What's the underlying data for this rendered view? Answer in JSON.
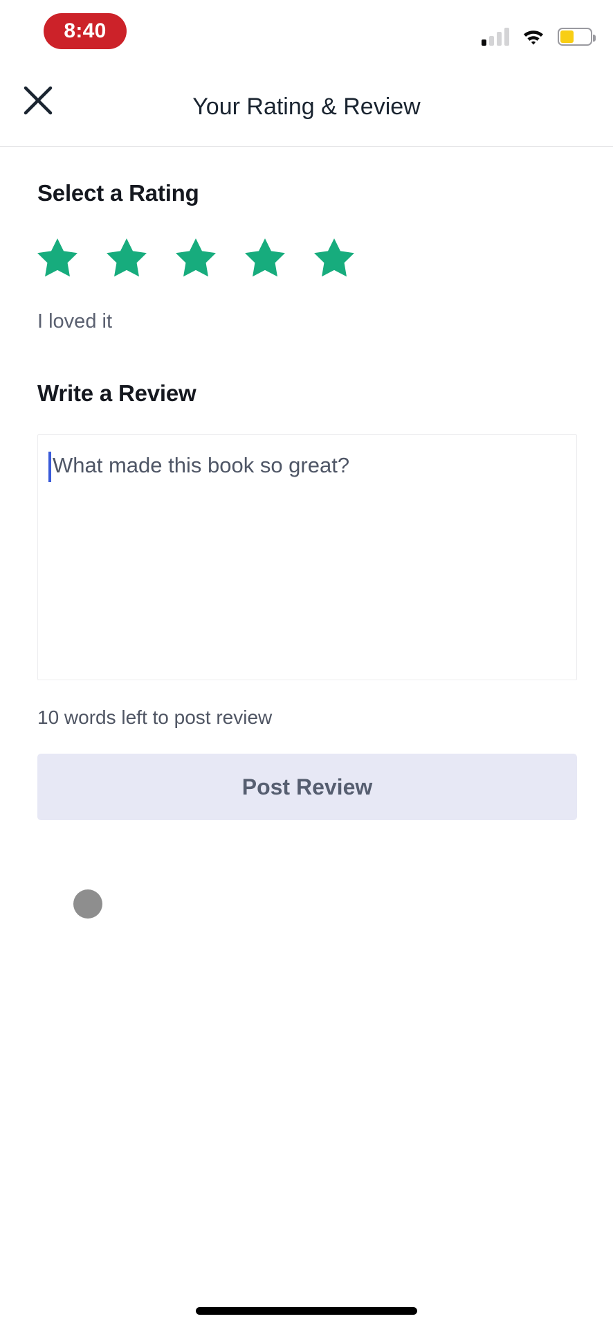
{
  "status_bar": {
    "time": "8:40",
    "time_pill_color": "#CC2229",
    "signal_icon": "cellular-signal-icon",
    "signal_bars_total": 4,
    "signal_bars_active": 1,
    "wifi_icon": "wifi-icon",
    "battery_icon": "battery-icon",
    "battery_level_percent": 45,
    "battery_color": "#F8CE14"
  },
  "nav": {
    "close_icon": "close-icon",
    "title": "Your Rating & Review"
  },
  "rating": {
    "section_title": "Select a Rating",
    "stars_total": 5,
    "stars_selected": 5,
    "star_color": "#17AC7D",
    "label": "I loved it"
  },
  "review": {
    "section_title": "Write a Review",
    "placeholder": "What made this book so great?",
    "value": "",
    "caret_color": "#3A5BD9",
    "word_count_text": "10 words left to post review",
    "post_button_label": "Post Review",
    "post_button_bg": "#E7E8F5",
    "post_button_text_color": "#565E70"
  },
  "misc": {
    "dot_indicator": "loading-dot",
    "dot_color": "#8E8E8E",
    "home_indicator": "home-indicator"
  }
}
